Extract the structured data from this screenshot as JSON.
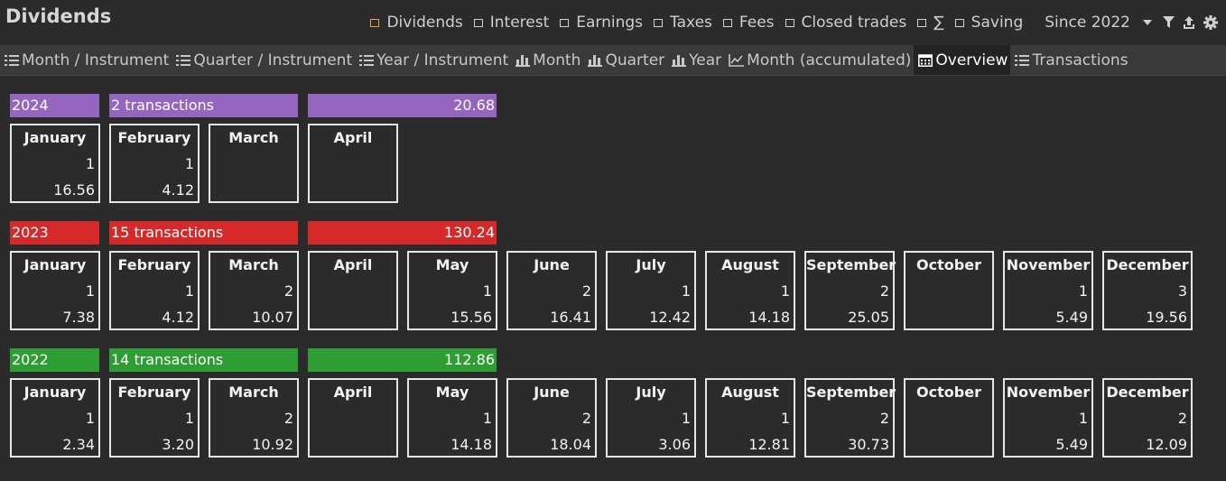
{
  "header": {
    "title": "Dividends",
    "filters": [
      {
        "label": "Dividends",
        "checked": true
      },
      {
        "label": "Interest",
        "checked": false
      },
      {
        "label": "Earnings",
        "checked": false
      },
      {
        "label": "Taxes",
        "checked": false
      },
      {
        "label": "Fees",
        "checked": false
      },
      {
        "label": "Closed trades",
        "checked": false
      },
      {
        "label": "∑",
        "checked": false
      },
      {
        "label": "Saving",
        "checked": false
      }
    ],
    "since": "Since 2022",
    "icons": [
      "filter-icon",
      "export-icon",
      "gear-icon"
    ]
  },
  "tabs": [
    {
      "label": "Month / Instrument",
      "icon": "list-icon",
      "active": false
    },
    {
      "label": "Quarter / Instrument",
      "icon": "list-icon",
      "active": false
    },
    {
      "label": "Year / Instrument",
      "icon": "list-icon",
      "active": false
    },
    {
      "label": "Month",
      "icon": "bar-chart-icon",
      "active": false
    },
    {
      "label": "Quarter",
      "icon": "bar-chart-icon",
      "active": false
    },
    {
      "label": "Year",
      "icon": "bar-chart-icon",
      "active": false
    },
    {
      "label": "Month (accumulated)",
      "icon": "line-chart-icon",
      "active": false
    },
    {
      "label": "Overview",
      "icon": "calendar-icon",
      "active": true
    },
    {
      "label": "Transactions",
      "icon": "list-icon",
      "active": false
    }
  ],
  "colors": {
    "2024": "#9466c0",
    "2023": "#d62a2a",
    "2022": "#2e9d34",
    "checked_filter": "#e8a23a"
  },
  "years": [
    {
      "year": "2024",
      "transactions": "2 transactions",
      "total": "20.68",
      "months": [
        {
          "name": "January",
          "count": "1",
          "value": "16.56"
        },
        {
          "name": "February",
          "count": "1",
          "value": "4.12"
        },
        {
          "name": "March",
          "count": "",
          "value": ""
        },
        {
          "name": "April",
          "count": "",
          "value": ""
        }
      ]
    },
    {
      "year": "2023",
      "transactions": "15 transactions",
      "total": "130.24",
      "months": [
        {
          "name": "January",
          "count": "1",
          "value": "7.38"
        },
        {
          "name": "February",
          "count": "1",
          "value": "4.12"
        },
        {
          "name": "March",
          "count": "2",
          "value": "10.07"
        },
        {
          "name": "April",
          "count": "",
          "value": ""
        },
        {
          "name": "May",
          "count": "1",
          "value": "15.56"
        },
        {
          "name": "June",
          "count": "2",
          "value": "16.41"
        },
        {
          "name": "July",
          "count": "1",
          "value": "12.42"
        },
        {
          "name": "August",
          "count": "1",
          "value": "14.18"
        },
        {
          "name": "September",
          "count": "2",
          "value": "25.05"
        },
        {
          "name": "October",
          "count": "",
          "value": ""
        },
        {
          "name": "November",
          "count": "1",
          "value": "5.49"
        },
        {
          "name": "December",
          "count": "3",
          "value": "19.56"
        }
      ]
    },
    {
      "year": "2022",
      "transactions": "14 transactions",
      "total": "112.86",
      "months": [
        {
          "name": "January",
          "count": "1",
          "value": "2.34"
        },
        {
          "name": "February",
          "count": "1",
          "value": "3.20"
        },
        {
          "name": "March",
          "count": "2",
          "value": "10.92"
        },
        {
          "name": "April",
          "count": "",
          "value": ""
        },
        {
          "name": "May",
          "count": "1",
          "value": "14.18"
        },
        {
          "name": "June",
          "count": "2",
          "value": "18.04"
        },
        {
          "name": "July",
          "count": "1",
          "value": "3.06"
        },
        {
          "name": "August",
          "count": "1",
          "value": "12.81"
        },
        {
          "name": "September",
          "count": "2",
          "value": "30.73"
        },
        {
          "name": "October",
          "count": "",
          "value": ""
        },
        {
          "name": "November",
          "count": "1",
          "value": "5.49"
        },
        {
          "name": "December",
          "count": "2",
          "value": "12.09"
        }
      ]
    }
  ]
}
